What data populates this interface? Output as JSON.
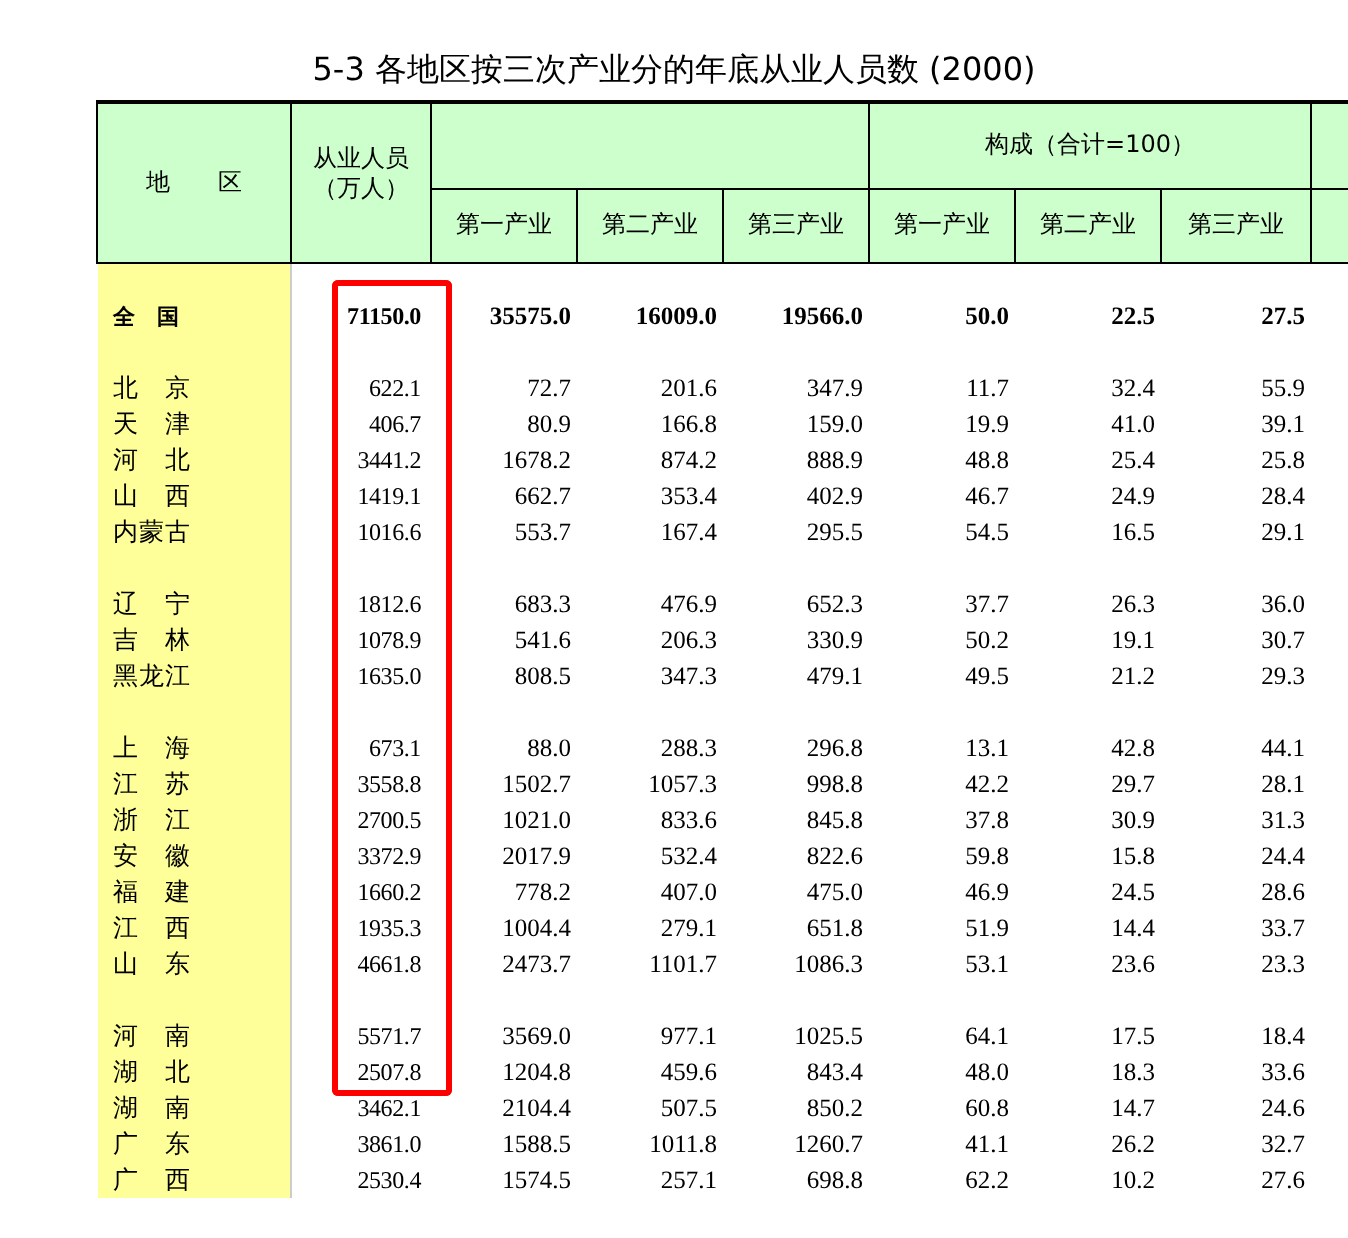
{
  "title": "5-3 各地区按三次产业分的年底从业人员数 (2000)",
  "header": {
    "region": "地　　区",
    "employed": [
      "从业人员",
      "（万人）"
    ],
    "composition": "构成（合计=100）",
    "subcolumns": [
      "第一产业",
      "第二产业",
      "第三产业",
      "第一产业",
      "第二产业",
      "第三产业"
    ]
  },
  "groups": [
    {
      "rows": [
        {
          "kind": "total",
          "region": "全　国",
          "values": [
            "71150.0",
            "35575.0",
            "16009.0",
            "19566.0",
            "50.0",
            "22.5",
            "27.5"
          ],
          "highlighted": true
        }
      ]
    },
    {
      "rows": [
        {
          "kind": "region",
          "region": "北　京",
          "values": [
            "622.1",
            "72.7",
            "201.6",
            "347.9",
            "11.7",
            "32.4",
            "55.9"
          ],
          "highlighted": true
        },
        {
          "kind": "region",
          "region": "天　津",
          "values": [
            "406.7",
            "80.9",
            "166.8",
            "159.0",
            "19.9",
            "41.0",
            "39.1"
          ],
          "highlighted": true
        },
        {
          "kind": "region",
          "region": "河　北",
          "values": [
            "3441.2",
            "1678.2",
            "874.2",
            "888.9",
            "48.8",
            "25.4",
            "25.8"
          ],
          "highlighted": true
        },
        {
          "kind": "region",
          "region": "山　西",
          "values": [
            "1419.1",
            "662.7",
            "353.4",
            "402.9",
            "46.7",
            "24.9",
            "28.4"
          ],
          "highlighted": true
        },
        {
          "kind": "region",
          "region": "内蒙古",
          "values": [
            "1016.6",
            "553.7",
            "167.4",
            "295.5",
            "54.5",
            "16.5",
            "29.1"
          ],
          "highlighted": true
        }
      ]
    },
    {
      "rows": [
        {
          "kind": "region",
          "region": "辽　宁",
          "values": [
            "1812.6",
            "683.3",
            "476.9",
            "652.3",
            "37.7",
            "26.3",
            "36.0"
          ],
          "highlighted": true
        },
        {
          "kind": "region",
          "region": "吉　林",
          "values": [
            "1078.9",
            "541.6",
            "206.3",
            "330.9",
            "50.2",
            "19.1",
            "30.7"
          ],
          "highlighted": true
        },
        {
          "kind": "region",
          "region": "黑龙江",
          "values": [
            "1635.0",
            "808.5",
            "347.3",
            "479.1",
            "49.5",
            "21.2",
            "29.3"
          ],
          "highlighted": true
        }
      ]
    },
    {
      "rows": [
        {
          "kind": "region",
          "region": "上　海",
          "values": [
            "673.1",
            "88.0",
            "288.3",
            "296.8",
            "13.1",
            "42.8",
            "44.1"
          ],
          "highlighted": true
        },
        {
          "kind": "region",
          "region": "江　苏",
          "values": [
            "3558.8",
            "1502.7",
            "1057.3",
            "998.8",
            "42.2",
            "29.7",
            "28.1"
          ],
          "highlighted": true
        },
        {
          "kind": "region",
          "region": "浙　江",
          "values": [
            "2700.5",
            "1021.0",
            "833.6",
            "845.8",
            "37.8",
            "30.9",
            "31.3"
          ],
          "highlighted": true
        },
        {
          "kind": "region",
          "region": "安　徽",
          "values": [
            "3372.9",
            "2017.9",
            "532.4",
            "822.6",
            "59.8",
            "15.8",
            "24.4"
          ],
          "highlighted": true
        },
        {
          "kind": "region",
          "region": "福　建",
          "values": [
            "1660.2",
            "778.2",
            "407.0",
            "475.0",
            "46.9",
            "24.5",
            "28.6"
          ],
          "highlighted": true
        },
        {
          "kind": "region",
          "region": "江　西",
          "values": [
            "1935.3",
            "1004.4",
            "279.1",
            "651.8",
            "51.9",
            "14.4",
            "33.7"
          ],
          "highlighted": true
        },
        {
          "kind": "region",
          "region": "山　东",
          "values": [
            "4661.8",
            "2473.7",
            "1101.7",
            "1086.3",
            "53.1",
            "23.6",
            "23.3"
          ],
          "highlighted": true
        }
      ]
    },
    {
      "rows": [
        {
          "kind": "region",
          "region": "河　南",
          "values": [
            "5571.7",
            "3569.0",
            "977.1",
            "1025.5",
            "64.1",
            "17.5",
            "18.4"
          ],
          "highlighted": true
        },
        {
          "kind": "region",
          "region": "湖　北",
          "values": [
            "2507.8",
            "1204.8",
            "459.6",
            "843.4",
            "48.0",
            "18.3",
            "33.6"
          ],
          "highlighted": true
        },
        {
          "kind": "region",
          "region": "湖　南",
          "values": [
            "3462.1",
            "2104.4",
            "507.5",
            "850.2",
            "60.8",
            "14.7",
            "24.6"
          ],
          "highlighted": false
        },
        {
          "kind": "region",
          "region": "广　东",
          "values": [
            "3861.0",
            "1588.5",
            "1011.8",
            "1260.7",
            "41.1",
            "26.2",
            "32.7"
          ],
          "highlighted": false
        },
        {
          "kind": "region",
          "region": "广　西",
          "values": [
            "2530.4",
            "1574.5",
            "257.1",
            "698.8",
            "62.2",
            "10.2",
            "27.6"
          ],
          "highlighted": false
        }
      ]
    }
  ]
}
